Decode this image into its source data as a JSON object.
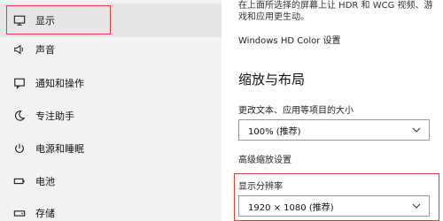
{
  "sidebar": {
    "items": [
      {
        "label": "显示",
        "icon": "monitor-icon",
        "active": true
      },
      {
        "label": "声音",
        "icon": "speaker-icon",
        "active": false
      },
      {
        "label": "通知和操作",
        "icon": "notification-icon",
        "active": false
      },
      {
        "label": "专注助手",
        "icon": "moon-icon",
        "active": false
      },
      {
        "label": "电源和睡眠",
        "icon": "power-icon",
        "active": false
      },
      {
        "label": "电池",
        "icon": "battery-icon",
        "active": false
      },
      {
        "label": "存储",
        "icon": "storage-icon",
        "active": false
      }
    ]
  },
  "content": {
    "description": "在上面所选择的屏幕上让 HDR 和 WCG 视频、游戏和应用更生动。",
    "hd_color_link": "Windows HD Color 设置",
    "scale_section_title": "缩放与布局",
    "text_size_label": "更改文本、应用等项目的大小",
    "text_size_value": "100% (推荐)",
    "advanced_scaling_link": "高级缩放设置",
    "resolution_label": "显示分辨率",
    "resolution_value": "1920 × 1080 (推荐)"
  },
  "colors": {
    "highlight": "#e0403a",
    "sidebar_bg": "#f2f2f2"
  }
}
